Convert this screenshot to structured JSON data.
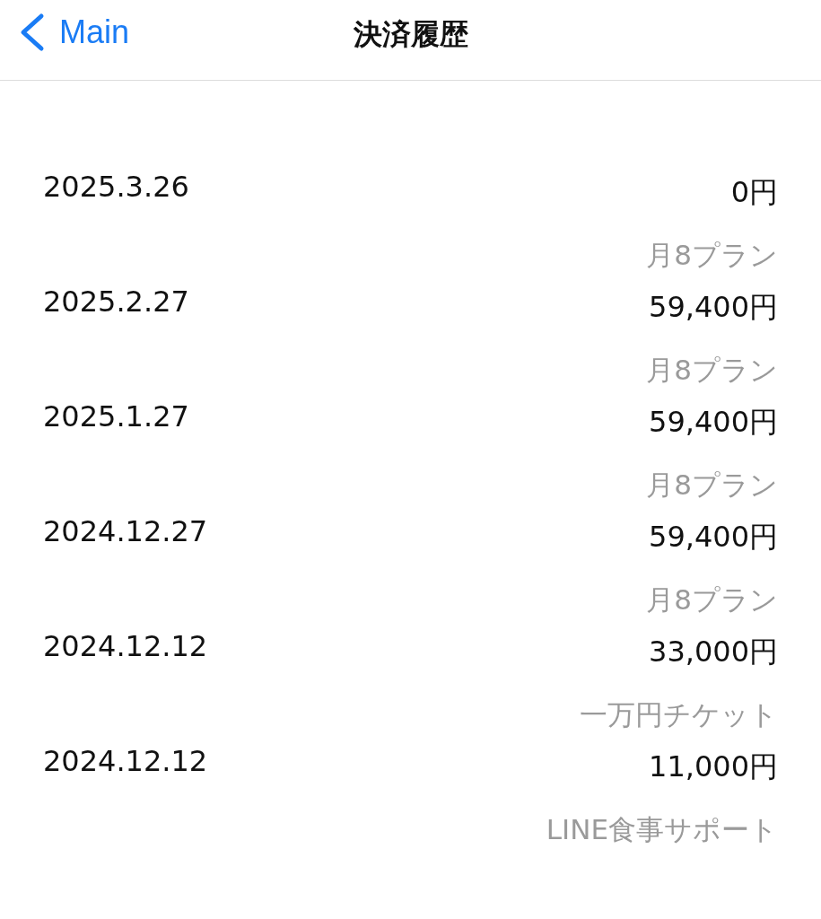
{
  "header": {
    "back_label": "Main",
    "title": "決済履歴"
  },
  "payments": [
    {
      "date": "2025.3.26",
      "amount": "0円",
      "plan": "月8プラン"
    },
    {
      "date": "2025.2.27",
      "amount": "59,400円",
      "plan": "月8プラン"
    },
    {
      "date": "2025.1.27",
      "amount": "59,400円",
      "plan": "月8プラン"
    },
    {
      "date": "2024.12.27",
      "amount": "59,400円",
      "plan": "月8プラン"
    },
    {
      "date": "2024.12.12",
      "amount": "33,000円",
      "plan": "一万円チケット"
    },
    {
      "date": "2024.12.12",
      "amount": "11,000円",
      "plan": "LINE食事サポート"
    }
  ]
}
